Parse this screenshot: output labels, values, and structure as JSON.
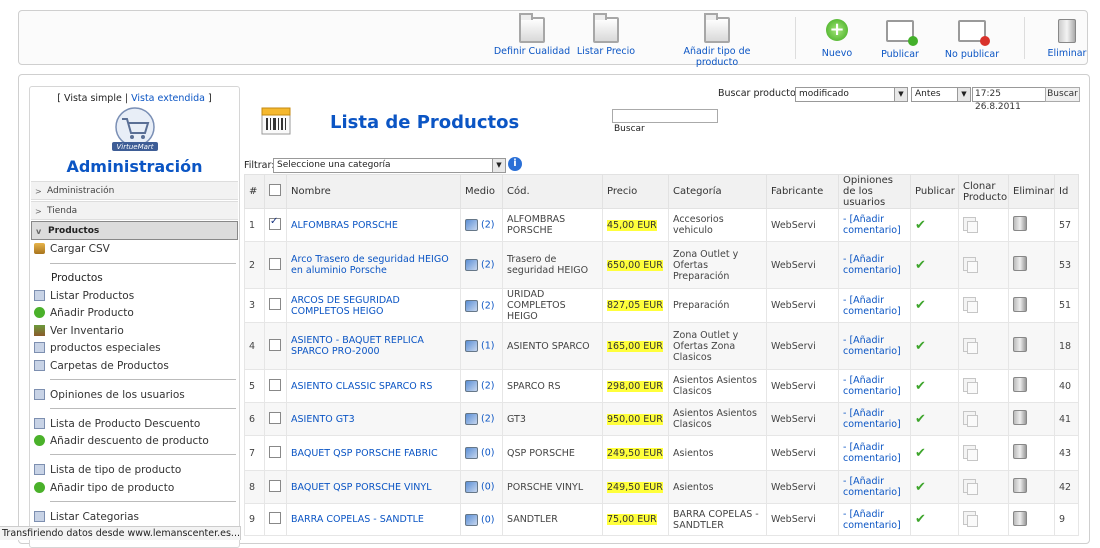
{
  "toolbar": {
    "buttons": [
      {
        "label": "Definir Cualidad",
        "icon": "folder-icon"
      },
      {
        "label": "Listar Precio",
        "icon": "folder-icon"
      },
      {
        "label": "Añadir tipo de producto",
        "icon": "folder-icon"
      },
      {
        "label": "Nuevo",
        "icon": "add-icon"
      },
      {
        "label": "Publicar",
        "icon": "publish-icon"
      },
      {
        "label": "No publicar",
        "icon": "unpublish-icon"
      },
      {
        "label": "Eliminar",
        "icon": "trash-icon"
      }
    ]
  },
  "sidebar": {
    "vista_simple": "[ Vista simple |",
    "vista_extendida": "Vista extendida",
    "vista_close": "]",
    "logo_text": "VirtueMart",
    "title": "Administración",
    "sections": [
      "Administración",
      "Tienda",
      "Productos"
    ],
    "cargar_csv": "Cargar CSV",
    "group_label": "Productos",
    "items": [
      "Listar Productos",
      "Añadir Producto",
      "Ver Inventario",
      "productos especiales",
      "Carpetas de Productos",
      "Opiniones de los usuarios",
      "Lista de Producto Descuento",
      "Añadir descuento de producto",
      "Lista de tipo de producto",
      "Añadir tipo de producto",
      "Listar Categorias"
    ]
  },
  "header": {
    "page_title": "Lista de Productos",
    "search_label": "Buscar",
    "buscar_producto_label": "Buscar producto",
    "filter_select": "modificado",
    "when_select": "Antes",
    "date_value": "17:25 26.8.2011",
    "buscar_button": "Buscar",
    "filtrar_label": "Filtrar:",
    "category_select": "Seleccione una categoría",
    "info_icon_text": "i"
  },
  "table": {
    "headers": [
      "#",
      "",
      "Nombre",
      "Medio",
      "Cód.",
      "Precio",
      "Categoría",
      "Fabricante",
      "Opiniones de los usuarios",
      "Publicar",
      "Clonar Producto",
      "Eliminar",
      "Id"
    ],
    "rows": [
      {
        "num": "1",
        "checked": true,
        "name": "ALFOMBRAS PORSCHE",
        "medio": "(2)",
        "cod": "ALFOMBRAS PORSCHE",
        "precio": "45,00 EUR",
        "categoria": "Accesorios vehiculo",
        "fabricante": "WebServi",
        "opinion": "- [Añadir comentario]",
        "id": "57"
      },
      {
        "num": "2",
        "checked": false,
        "name": "Arco Trasero de seguridad HEIGO en aluminio Porsche",
        "medio": "(2)",
        "cod": "Trasero de seguridad HEIGO",
        "precio": "650,00 EUR",
        "categoria": "Zona Outlet y Ofertas Preparación",
        "fabricante": "WebServi",
        "opinion": "- [Añadir comentario]",
        "id": "53"
      },
      {
        "num": "3",
        "checked": false,
        "name": "ARCOS DE SEGURIDAD COMPLETOS HEIGO",
        "medio": "(2)",
        "cod": "URIDAD COMPLETOS HEIGO",
        "precio": "827,05 EUR",
        "categoria": "Preparación",
        "fabricante": "WebServi",
        "opinion": "- [Añadir comentario]",
        "id": "51"
      },
      {
        "num": "4",
        "checked": false,
        "name": "ASIENTO - BAQUET REPLICA SPARCO PRO-2000",
        "medio": "(1)",
        "cod": "ASIENTO SPARCO",
        "precio": "165,00 EUR",
        "categoria": "Zona Outlet y Ofertas Zona Clasicos",
        "fabricante": "WebServi",
        "opinion": "- [Añadir comentario]",
        "id": "18"
      },
      {
        "num": "5",
        "checked": false,
        "name": "ASIENTO CLASSIC SPARCO RS",
        "medio": "(2)",
        "cod": "SPARCO RS",
        "precio": "298,00 EUR",
        "categoria": "Asientos Asientos Clasicos",
        "fabricante": "WebServi",
        "opinion": "- [Añadir comentario]",
        "id": "40"
      },
      {
        "num": "6",
        "checked": false,
        "name": "ASIENTO GT3",
        "medio": "(2)",
        "cod": "GT3",
        "precio": "950,00 EUR",
        "categoria": "Asientos Asientos Clasicos",
        "fabricante": "WebServi",
        "opinion": "- [Añadir comentario]",
        "id": "41"
      },
      {
        "num": "7",
        "checked": false,
        "name": "BAQUET QSP PORSCHE FABRIC",
        "medio": "(0)",
        "cod": "QSP PORSCHE",
        "precio": "249,50 EUR",
        "categoria": "Asientos",
        "fabricante": "WebServi",
        "opinion": "- [Añadir comentario]",
        "id": "43"
      },
      {
        "num": "8",
        "checked": false,
        "name": "BAQUET QSP PORSCHE VINYL",
        "medio": "(0)",
        "cod": "PORSCHE VINYL",
        "precio": "249,50 EUR",
        "categoria": "Asientos",
        "fabricante": "WebServi",
        "opinion": "- [Añadir comentario]",
        "id": "42"
      },
      {
        "num": "9",
        "checked": false,
        "name": "BARRA COPELAS - SANDTLE",
        "medio": "(0)",
        "cod": "SANDTLER",
        "precio": "75,00 EUR",
        "categoria": "BARRA COPELAS - SANDTLER",
        "fabricante": "WebServi",
        "opinion": "- [Añadir comentario]",
        "id": "9"
      }
    ]
  },
  "status_bar": {
    "text": "Transfiriendo datos desde www.lemanscenter.es..."
  }
}
